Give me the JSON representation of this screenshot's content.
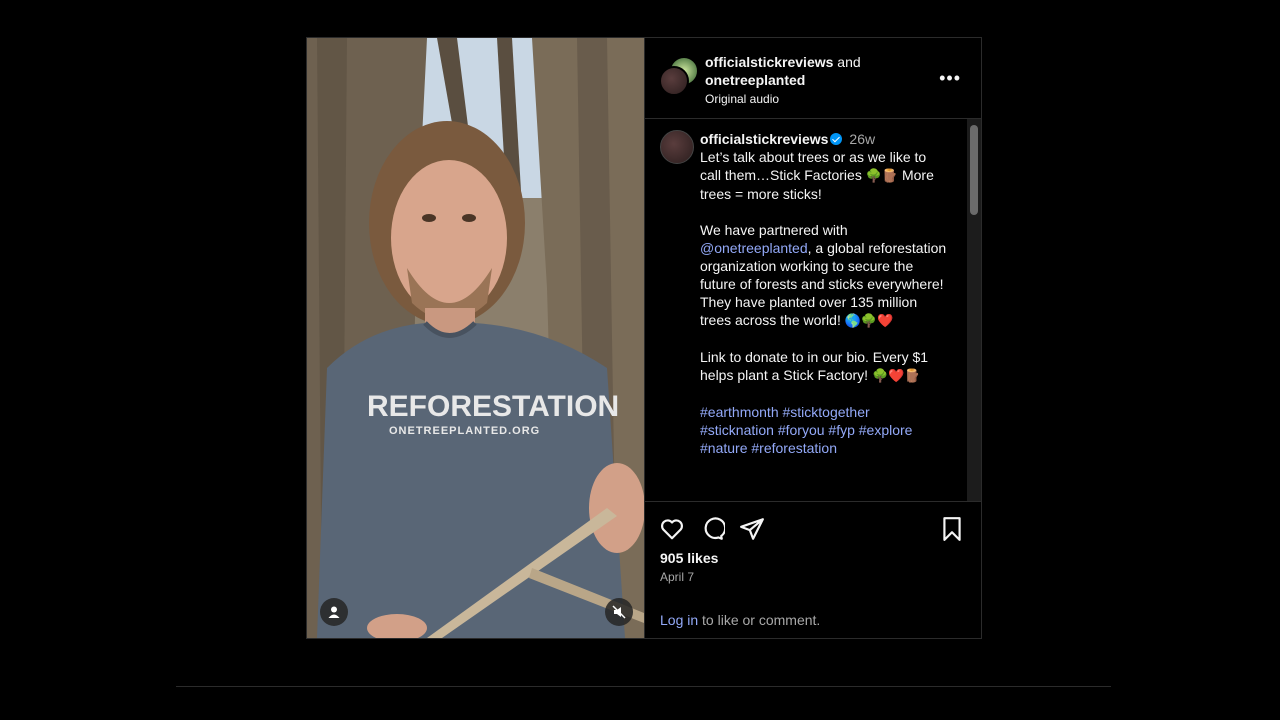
{
  "header": {
    "user1": "officialstickreviews",
    "joiner": "and",
    "user2": "onetreeplanted",
    "audio": "Original audio",
    "more_icon": "more-options-icon"
  },
  "caption": {
    "username": "officialstickreviews",
    "age": "26w",
    "line1": "Let’s talk about trees or as we like to call them…Stick Factories",
    "emoji1": "🌳🪵",
    "line1b": "More trees = more sticks!",
    "p2_pre": "We have partnered with",
    "mention": "@onetreeplanted",
    "p2_post": ", a global reforestation organization working to secure the future of forests and sticks everywhere! They have planted over 135 million trees across the world!",
    "emoji2": "🌎🌳❤️",
    "p3": "Link to donate to in our bio. Every $1 helps plant a Stick Factory!",
    "emoji3": "🌳❤️🪵",
    "hashtags_line1": "#earthmonth #sticktogether",
    "hashtags_line2": "#sticknation #foryou #fyp #explore",
    "hashtags_line3": "#nature #reforestation"
  },
  "media": {
    "shirt_text": "REFORESTATION",
    "shirt_sub": "ONETREEPLANTED.ORG"
  },
  "actions": {
    "likes": "905 likes",
    "date": "April 7",
    "login_link": "Log in",
    "login_rest": " to like or comment."
  },
  "colors": {
    "link": "#93a9f8",
    "verified": "#0095f6"
  }
}
